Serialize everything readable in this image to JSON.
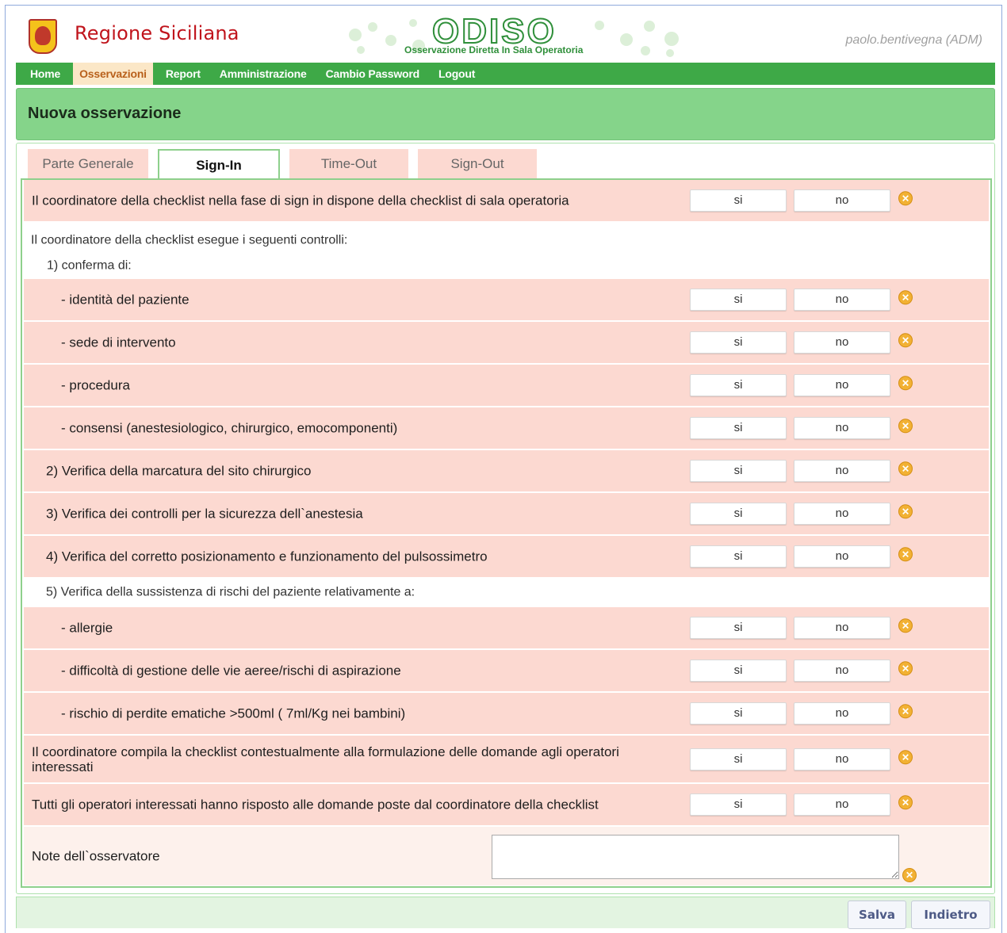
{
  "header": {
    "region_name": "Regione Siciliana",
    "app_title": "ODISO",
    "app_subtitle": "Osservazione Diretta In Sala Operatoria",
    "user": "paolo.bentivegna (ADM)"
  },
  "nav": {
    "items": [
      "Home",
      "Osservazioni",
      "Report",
      "Amministrazione",
      "Cambio Password",
      "Logout"
    ],
    "active": "Osservazioni"
  },
  "page_title": "Nuova osservazione",
  "tabs": [
    "Parte Generale",
    "Sign-In",
    "Time-Out",
    "Sign-Out"
  ],
  "active_tab": "Sign-In",
  "buttons": {
    "yes": "si",
    "no": "no"
  },
  "checklist": [
    "Il coordinatore della checklist nella fase di sign in dispone della checklist di sala operatoria",
    "Il coordinatore della checklist esegue i seguenti controlli:",
    "1) conferma di:",
    "- identità del paziente",
    "- sede di intervento",
    "- procedura",
    "- consensi (anestesiologico, chirurgico, emocomponenti)",
    "2) Verifica della marcatura del sito chirurgico",
    "3) Verifica dei controlli per la sicurezza dell`anestesia",
    "4) Verifica del corretto posizionamento e funzionamento del pulsossimetro",
    "5) Verifica della sussistenza di rischi del paziente relativamente a:",
    "- allergie",
    "- difficoltà di gestione delle vie aeree/rischi di aspirazione",
    "- rischio di perdite ematiche >500ml ( 7ml/Kg nei bambini)",
    "Il coordinatore compila la checklist contestualmente alla formulazione delle domande agli operatori interessati",
    "Tutti gli operatori interessati hanno risposto alle domande poste dal coordinatore della checklist"
  ],
  "notes_label": "Note dell`osservatore",
  "footer": {
    "save": "Salva",
    "back": "Indietro"
  },
  "colors": {
    "nav_green": "#3ea947",
    "title_green": "#85d48a",
    "row_pink": "#fcd9d1",
    "brand_red": "#c0141c",
    "clear_icon": "#f2b134"
  }
}
